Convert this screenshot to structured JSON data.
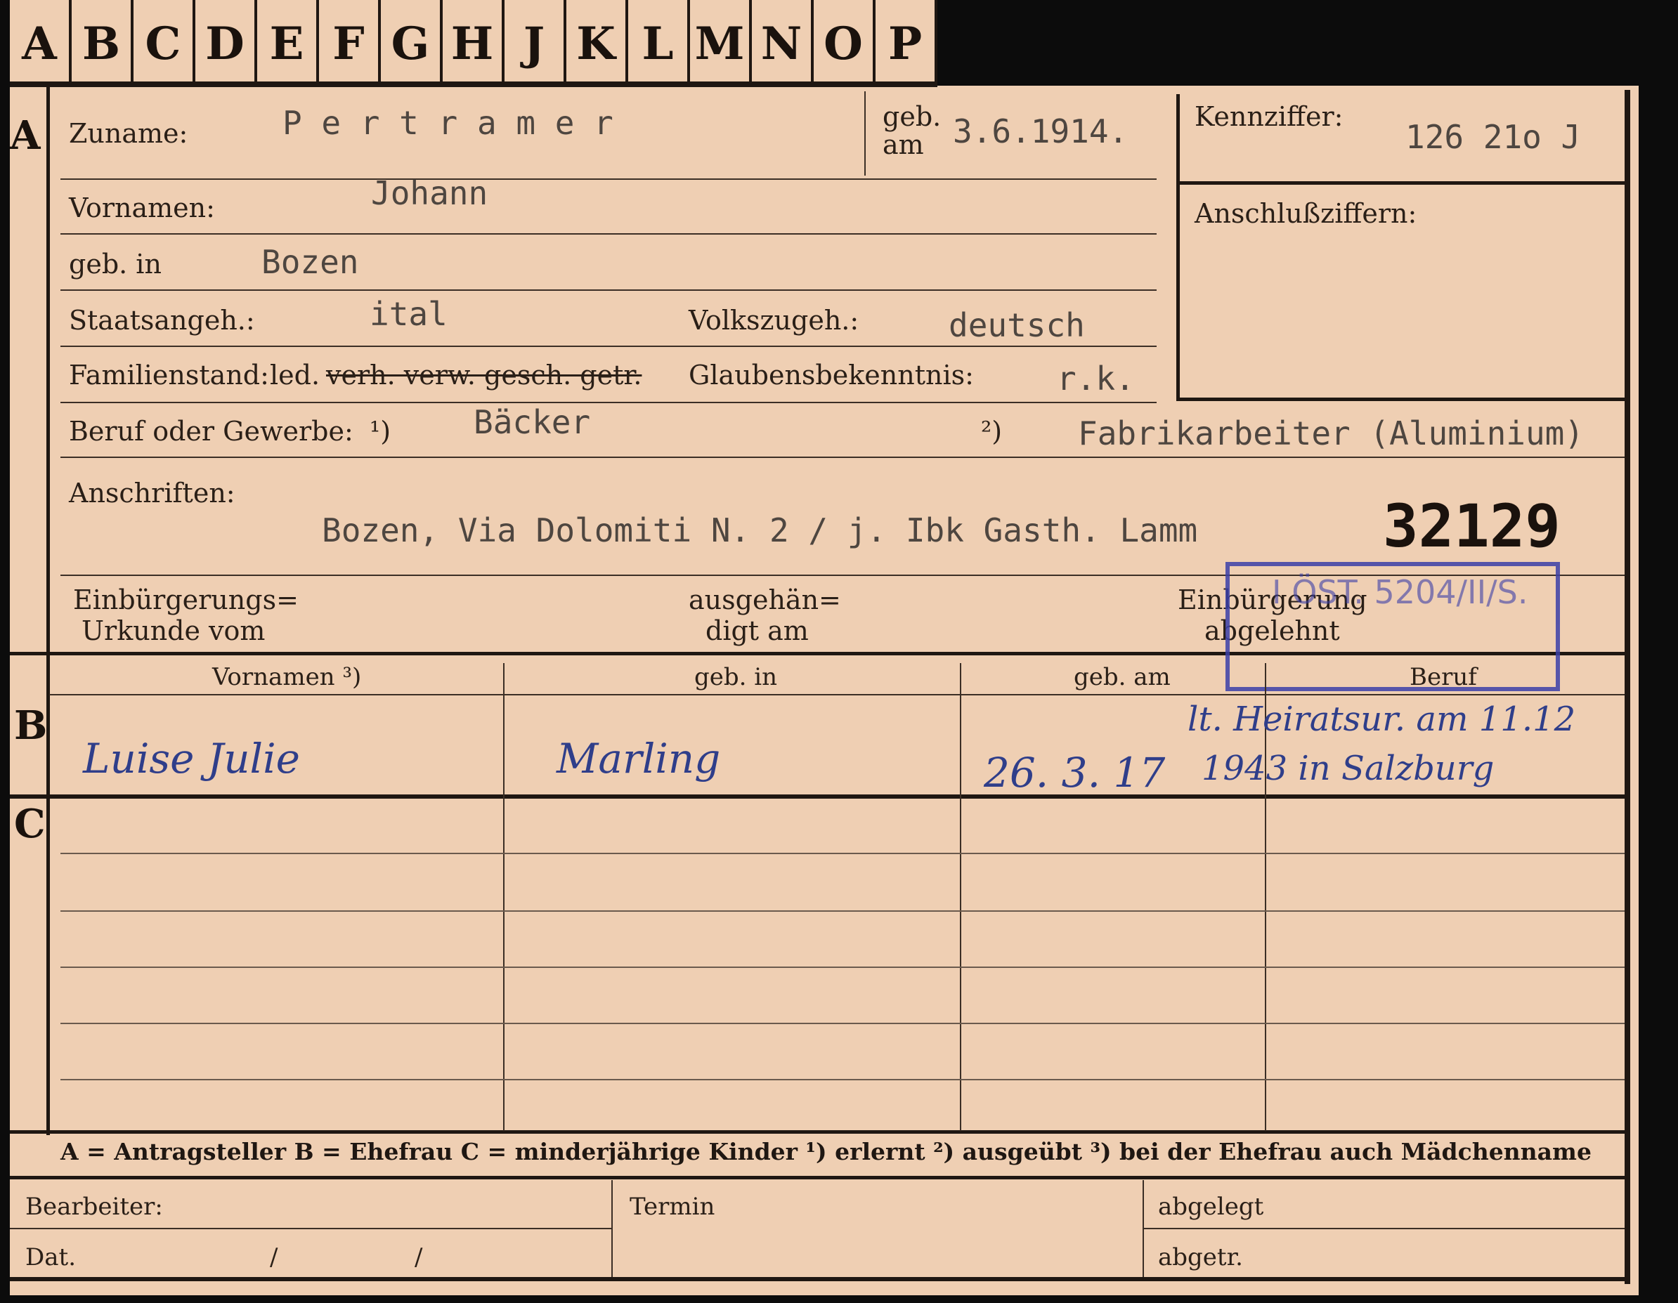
{
  "tabs": [
    "A",
    "B",
    "C",
    "D",
    "E",
    "F",
    "G",
    "H",
    "J",
    "K",
    "L",
    "M",
    "N",
    "O",
    "P"
  ],
  "section_letters": {
    "a": "A",
    "b": "B",
    "c": "C"
  },
  "applicant": {
    "surname_label": "Zuname:",
    "surname": "P e r t r a m e r",
    "born_on_label_1": "geb.",
    "born_on_label_2": "am",
    "born_on": "3.6.1914.",
    "first_names_label": "Vornamen:",
    "first_names": "Johann",
    "birthplace_label": "geb. in",
    "birthplace": "Bozen",
    "citizenship_label": "Staatsangeh.:",
    "citizenship": "ital",
    "ethnicity_label": "Volkszugeh.:",
    "ethnicity": "deutsch",
    "marital_label": "Familienstand:",
    "marital_selected": "led.",
    "marital_struck": "verh. verw. gesch. getr.",
    "religion_label": "Glaubensbekenntnis:",
    "religion": "r.k.",
    "occupation_label": "Beruf oder Gewerbe:",
    "occupation_mark_1": "¹)",
    "occupation_learned": "Bäcker",
    "occupation_mark_2": "²)",
    "occupation_practised": "Fabrikarbeiter (Aluminium)",
    "address_label": "Anschriften:",
    "address": "Bozen, Via Dolomiti  N. 2  / j. Ibk Gasth. Lamm",
    "file_number": "32129",
    "naturalization_label_1": "Einbürgerungs=",
    "naturalization_label_2": "Urkunde vom",
    "issued_label_1": "ausgehän=",
    "issued_label_2": "digt am",
    "rejected_label_1": "Einbürgerung",
    "rejected_label_2": "abgelehnt",
    "stamp_text": "I ÖST. 5204/II/S."
  },
  "reference": {
    "id_label": "Kennziffer:",
    "id_value": "126 21o J",
    "related_label": "Anschlußziffern:"
  },
  "table": {
    "headers": [
      "Vornamen ³)",
      "geb. in",
      "geb. am",
      "Beruf"
    ],
    "wife": {
      "first_names": "Luise Julie",
      "birthplace": "Marling",
      "birthdate": "26. 3. 17",
      "note_line1": "lt. Heiratsur. am 11.12",
      "note_line2": "1943 in Salzburg"
    }
  },
  "legend": "A = Antragsteller   B = Ehefrau   C = minderjährige Kinder   ¹) erlernt   ²) ausgeübt   ³) bei der Ehefrau auch Mädchenname",
  "footer": {
    "clerk_label": "Bearbeiter:",
    "date_label": "Dat.",
    "date_sep1": "/",
    "date_sep2": "/",
    "deadline_label": "Termin",
    "filed_label": "abgelegt",
    "removed_label": "abgetr."
  }
}
